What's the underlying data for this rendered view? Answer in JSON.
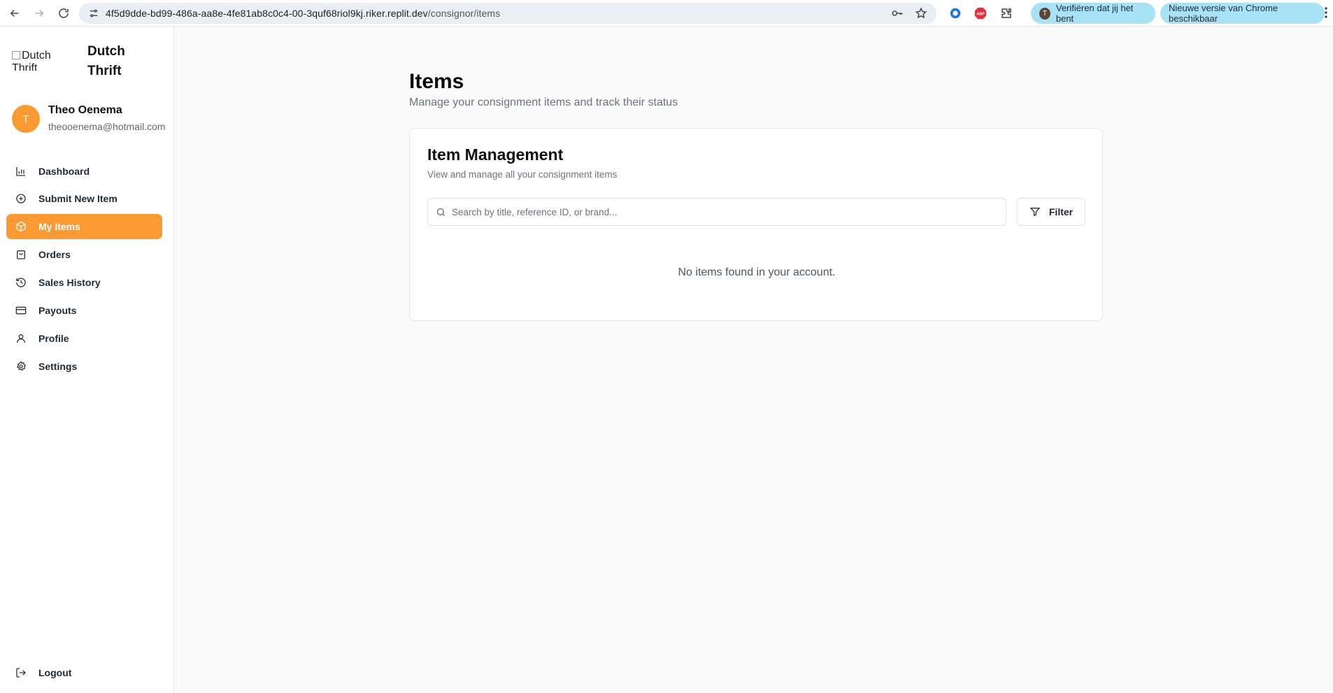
{
  "browser": {
    "url_host": "4f5d9dde-bd99-486a-aa8e-4fe81ab8c0c4-00-3quf68riol9kj.riker.replit.dev",
    "url_path": "/consignor/items",
    "profile_initial": "T",
    "verify_pill": "Verifiëren dat jij het bent",
    "update_pill": "Nieuwe versie van Chrome beschikbaar",
    "ext_abp_label": "ABP"
  },
  "sidebar": {
    "logo_alt": "Dutch Thrift",
    "brand_line1": "Dutch",
    "brand_line2": "Thrift",
    "user": {
      "initial": "T",
      "name": "Theo Oenema",
      "email": "theooenema@hotmail.com"
    },
    "items": [
      {
        "label": "Dashboard",
        "icon": "bar-chart-icon"
      },
      {
        "label": "Submit New Item",
        "icon": "plus-circle-icon"
      },
      {
        "label": "My Items",
        "icon": "package-icon",
        "active": true
      },
      {
        "label": "Orders",
        "icon": "shopping-bag-icon"
      },
      {
        "label": "Sales History",
        "icon": "history-icon"
      },
      {
        "label": "Payouts",
        "icon": "credit-card-icon"
      },
      {
        "label": "Profile",
        "icon": "user-icon"
      },
      {
        "label": "Settings",
        "icon": "gear-icon"
      }
    ],
    "logout_label": "Logout"
  },
  "main": {
    "title": "Items",
    "subtitle": "Manage your consignment items and track their status",
    "card": {
      "title": "Item Management",
      "subtitle": "View and manage all your consignment items",
      "search_placeholder": "Search by title, reference ID, or brand...",
      "filter_label": "Filter",
      "empty_message": "No items found in your account."
    }
  },
  "colors": {
    "accent": "#fb9a33",
    "page_bg": "#fafafa",
    "pill_bg": "#a8e2f5"
  }
}
